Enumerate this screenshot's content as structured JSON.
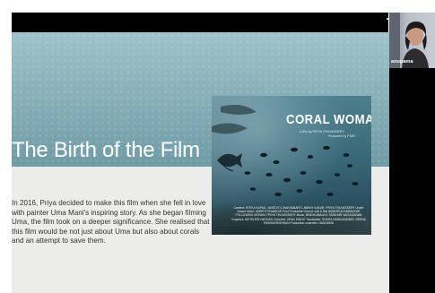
{
  "slide": {
    "title": "The Birth of the Film",
    "body": "In 2016, Priya decided to make this film when she fell in love with painter Uma Mani's inspiring story. As she began filming Uma, the film took on a deeper significance. She realised that this film would be not just about Uma but also about corals and an attempt to save them."
  },
  "poster": {
    "title": "CORAL WOMAN",
    "subtitle": "A film by PRIYA THUVASSERY",
    "produced_by": "Produced by PSBT",
    "credits": "Camera: RITIKA KAPAIL, NIVEDITI CHAKRABARTI, ABHAY KAKAR, PRIYA THUVASSERY Under Sound Mixer: AMRITH SHANKAR Post Production Sound: edit & Mix AVANTIKA NIMBALKAR FOLLOWING MOHAN, PRIYA THUVASSERY Music: BINDHUMALINI, SIDDHAR VAISAGANAN Graphics: MITHILESH MOHAN Colourist: VENU SINGH Translation: SHARA NANDAKUMAR, REENA RADHAKRISHNAN Production controller: UMA MANI"
  },
  "participant": {
    "name": "anupama"
  },
  "colors": {
    "banner": "#84adb7",
    "slide_bg": "#ececeb",
    "panel": "#000000"
  }
}
